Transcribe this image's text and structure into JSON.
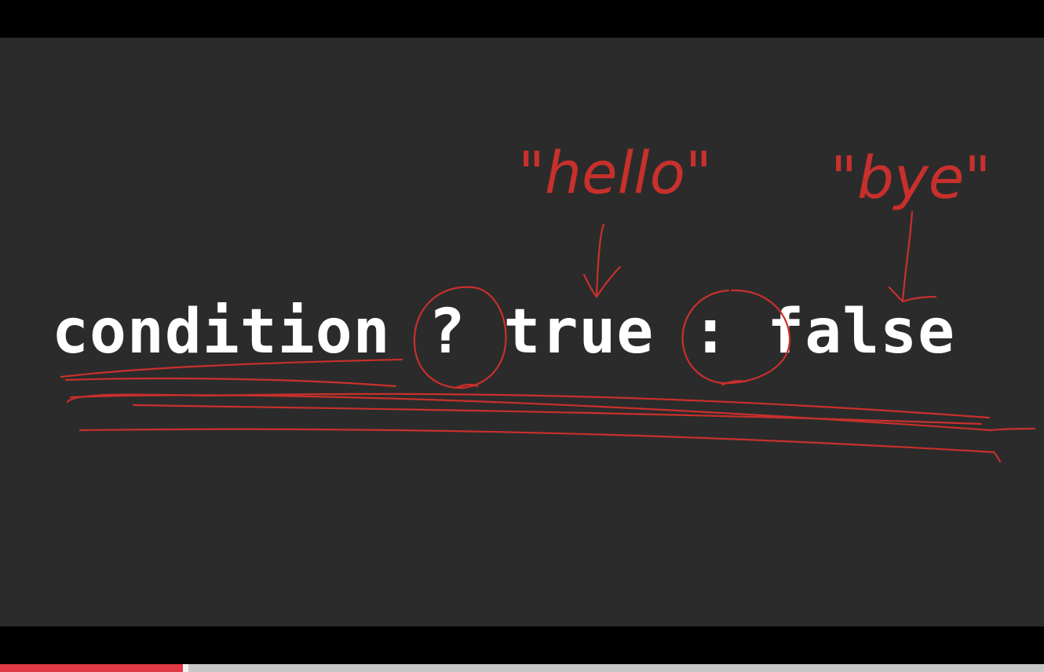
{
  "slide": {
    "code_tokens": {
      "condition": "condition",
      "question": "?",
      "true_branch": "true",
      "colon": ":",
      "false_branch": "false"
    },
    "annotations": {
      "true_label": "\"hello\"",
      "false_label": "\"bye\""
    }
  },
  "player": {
    "progress_fraction": 0.175
  },
  "colors": {
    "background": "#2b2b2b",
    "ink": "#c9302c",
    "progress_played": "#e03a45",
    "progress_track": "#c8c8c8"
  }
}
